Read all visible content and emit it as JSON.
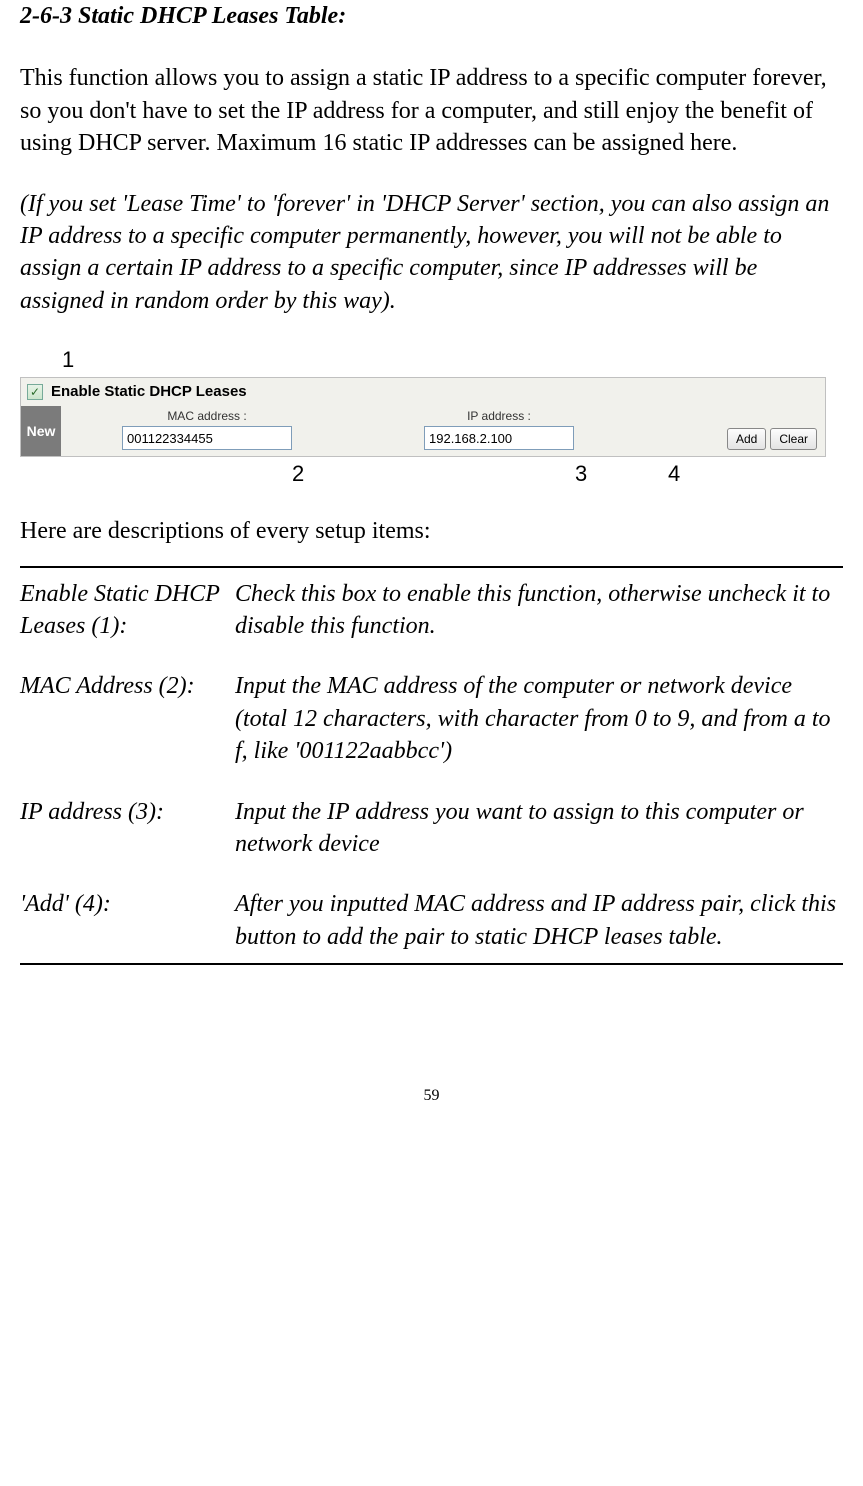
{
  "section_title": "2-6-3 Static DHCP Leases Table:",
  "para_intro": "This function allows you to assign a static IP address to a specific computer forever, so you don't have to set the IP address for a computer, and still enjoy the benefit of using DHCP server. Maximum 16 static IP addresses can be assigned here.",
  "para_note": "(If you set 'Lease Time' to 'forever' in 'DHCP Server' section, you can also assign an IP address to a specific computer permanently, however, you will not be able to assign a certain IP address to a specific computer, since IP addresses will be assigned in random order by this way).",
  "callouts": {
    "c1": "1",
    "c2": "2",
    "c3": "3",
    "c4": "4"
  },
  "ui": {
    "enable_label": "Enable Static DHCP Leases",
    "new_label": "New",
    "mac_header": "MAC address :",
    "ip_header": "IP address :",
    "mac_value": "001122334455",
    "ip_value": "192.168.2.100",
    "add_btn": "Add",
    "clear_btn": "Clear",
    "checkmark": "✓"
  },
  "desc_intro": "Here are descriptions of every setup items:",
  "descriptions": [
    {
      "label": "Enable Static DHCP Leases (1):",
      "text": "Check this box to enable this function, otherwise uncheck it to disable this function."
    },
    {
      "label": "MAC Address (2):",
      "text": "Input the MAC address of the computer or network device (total 12 characters, with character from 0 to 9, and from a to f, like '001122aabbcc')"
    },
    {
      "label": "IP address (3):",
      "text": "Input the IP address you want to assign to this computer or network device"
    },
    {
      "label": "'Add' (4):",
      "text": "After you inputted MAC address and IP address pair, click this button to add the pair to static DHCP leases table."
    }
  ],
  "page_number": "59"
}
